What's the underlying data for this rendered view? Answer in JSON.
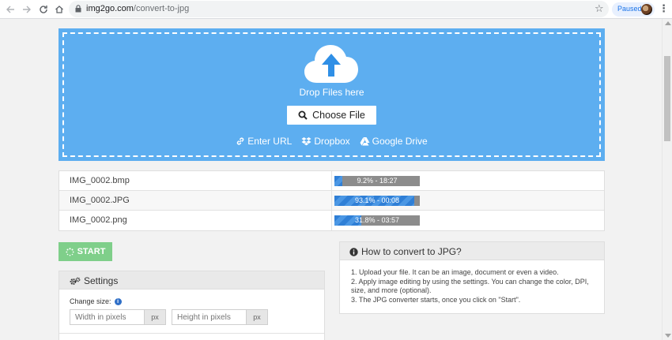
{
  "browser": {
    "url_host": "img2go.com",
    "url_path": "/convert-to-jpg",
    "profile_status": "Paused"
  },
  "dropzone": {
    "drop_text": "Drop Files here",
    "choose_label": "Choose File",
    "sources": [
      {
        "label": "Enter URL",
        "icon": "link-icon"
      },
      {
        "label": "Dropbox",
        "icon": "dropbox-icon"
      },
      {
        "label": "Google Drive",
        "icon": "google-drive-icon"
      }
    ],
    "bg_color": "#5daef0"
  },
  "files": [
    {
      "name": "IMG_0002.bmp",
      "status": "9.2% - 18:27",
      "progress": 0.092
    },
    {
      "name": "IMG_0002.JPG",
      "status": "93.1% - 00:08",
      "progress": 0.931
    },
    {
      "name": "IMG_0002.png",
      "status": "31.8% - 03:57",
      "progress": 0.318
    }
  ],
  "start_label": "START",
  "settings": {
    "title": "Settings",
    "change_size_label": "Change size:",
    "width_placeholder": "Width in pixels",
    "height_placeholder": "Height in pixels",
    "unit": "px"
  },
  "howto": {
    "title": "How to convert to JPG?",
    "steps": [
      "1. Upload your file. It can be an image, document or even a video.",
      "2. Apply image editing by using the settings. You can change the color, DPI, size, and more (optional).",
      "3. The JPG converter starts, once you click on \"Start\"."
    ]
  },
  "colors": {
    "accent": "#5daef0",
    "start_button": "#7fcf8a",
    "progress_fill": "#2f7fd6"
  }
}
